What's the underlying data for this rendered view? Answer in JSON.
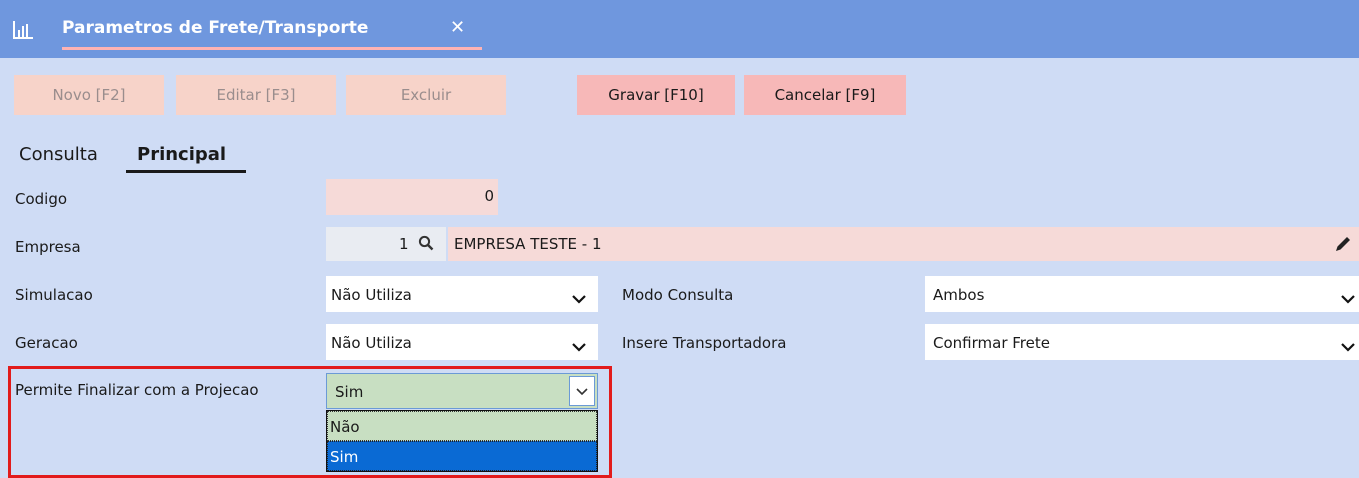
{
  "tab": {
    "title": "Parametros de Frete/Transporte",
    "close": "✕"
  },
  "toolbar": {
    "novo": "Novo [F2]",
    "editar": "Editar [F3]",
    "excluir": "Excluir",
    "gravar": "Gravar [F10]",
    "cancelar": "Cancelar [F9]"
  },
  "subtabs": {
    "consulta": "Consulta",
    "principal": "Principal"
  },
  "form": {
    "codigo": {
      "label": "Codigo",
      "value": "0"
    },
    "empresa": {
      "label": "Empresa",
      "code": "1",
      "name": "EMPRESA TESTE - 1"
    },
    "simulacao": {
      "label": "Simulacao",
      "value": "Não Utiliza"
    },
    "modo_consulta": {
      "label": "Modo Consulta",
      "value": "Ambos"
    },
    "geracao": {
      "label": "Geracao",
      "value": "Não Utiliza"
    },
    "insere_transportadora": {
      "label": "Insere Transportadora",
      "value": "Confirmar Frete"
    },
    "permite_finalizar": {
      "label": "Permite Finalizar com a Projecao",
      "value": "Sim",
      "options": [
        "Não",
        "Sim"
      ]
    }
  },
  "colors": {
    "title_bar": "#6f97de",
    "background": "#cfdcf5",
    "highlight": "#e21b1b",
    "selected_option": "#0a6ad4"
  }
}
